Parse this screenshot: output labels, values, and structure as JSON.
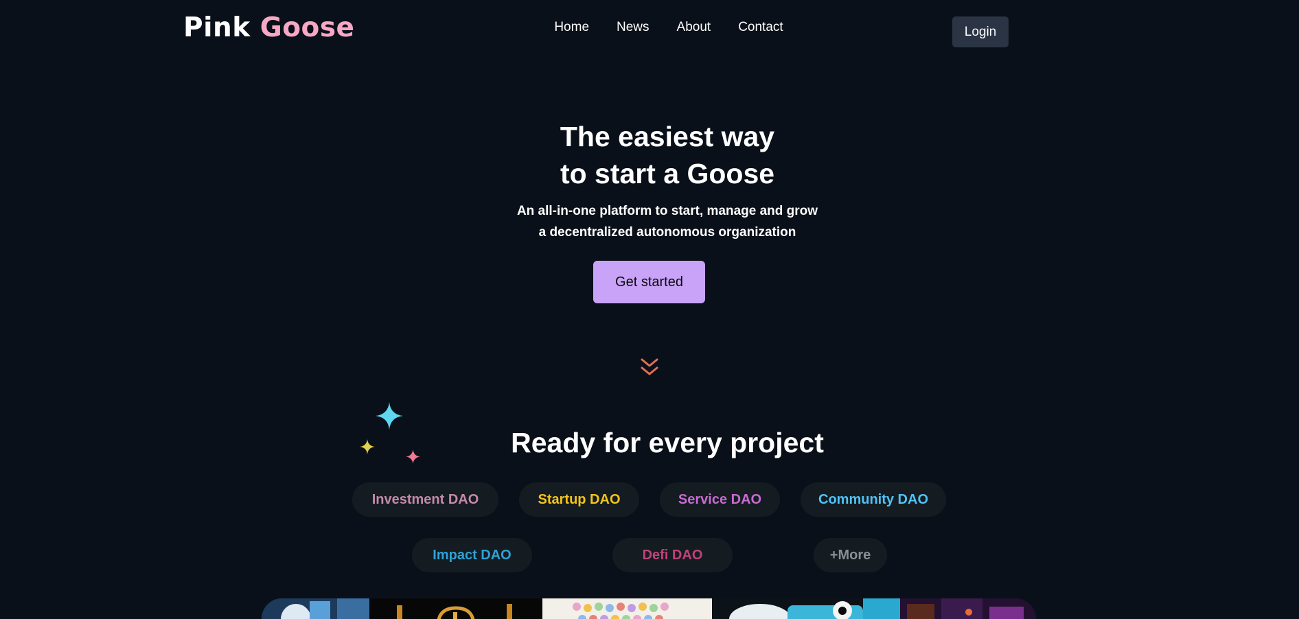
{
  "header": {
    "logo_part1": "Pink",
    "logo_part2": "Goose",
    "nav": [
      "Home",
      "News",
      "About",
      "Contact"
    ],
    "login_label": "Login"
  },
  "hero": {
    "title_line1": "The easiest way",
    "title_line2": "to start a Goose",
    "subtitle_line1": "An all-in-one platform to start, manage and grow",
    "subtitle_line2": "a decentralized autonomous organization",
    "cta_label": "Get started"
  },
  "section": {
    "title": "Ready for every project",
    "tags": [
      {
        "label": "Investment DAO",
        "color": "#c58aa8"
      },
      {
        "label": "Startup DAO",
        "color": "#f5c518"
      },
      {
        "label": "Service DAO",
        "color": "#c86ad0"
      },
      {
        "label": "Community DAO",
        "color": "#4fc3f7"
      },
      {
        "label": "Impact DAO",
        "color": "#2fa2d8"
      },
      {
        "label": "Defi DAO",
        "color": "#c2417a"
      },
      {
        "label": "+More",
        "color": "#8a8f96"
      }
    ]
  },
  "icons": {
    "scroll_down": "double-chevron-down-icon",
    "sparkles": [
      "sparkle-cyan-icon",
      "sparkle-yellow-icon",
      "sparkle-pink-icon"
    ]
  },
  "colors": {
    "background": "#0a1019",
    "accent_pink": "#f7a8c5",
    "cta": "#c9a3f7",
    "login_bg": "#2a3444",
    "pill_bg": "#141c21"
  }
}
